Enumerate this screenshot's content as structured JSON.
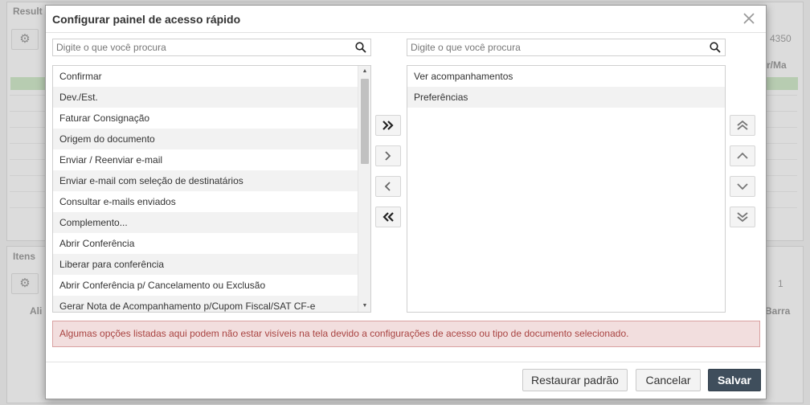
{
  "background": {
    "results_label": "Result",
    "items_label": "Itens",
    "count_right": "4350",
    "page_right": "1",
    "col_right_top": "r/Ma",
    "col_right_bottom": "Barra",
    "col_left_bottom": "Ali"
  },
  "modal": {
    "title": "Configurar painel de acesso rápido",
    "close_glyph": "✕",
    "left_search_placeholder": "Digite o que você procura",
    "right_search_placeholder": "Digite o que você procura",
    "available_items": [
      "Confirmar",
      "Dev./Est.",
      "Faturar Consignação",
      "Origem do documento",
      "Enviar / Reenviar e-mail",
      "Enviar e-mail com seleção de destinatários",
      "Consultar e-mails enviados",
      "Complemento...",
      "Abrir Conferência",
      "Liberar para conferência",
      "Abrir Conferência p/ Cancelamento ou Exclusão",
      "Gerar Nota de Acompanhamento p/Cupom Fiscal/SAT CF-e"
    ],
    "selected_items": [
      "Ver acompanhamentos",
      "Preferências"
    ],
    "alert_text": "Algumas opções listadas aqui podem não estar visíveis na tela devido a configurações de acesso ou tipo de documento selecionado.",
    "buttons": {
      "restore": "Restaurar padrão",
      "cancel": "Cancelar",
      "save": "Salvar"
    }
  },
  "colors": {
    "primary_button": "#3f4e5c",
    "alert_bg": "#f2dede",
    "alert_text": "#a94442"
  }
}
